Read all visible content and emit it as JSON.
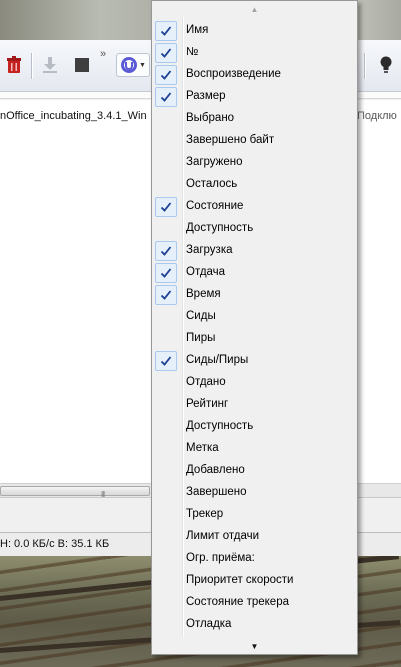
{
  "app": {
    "toolbar": {
      "buttons": [
        {
          "name": "delete-button",
          "icon": "trash-icon"
        },
        {
          "name": "download-button",
          "icon": "download-icon"
        },
        {
          "name": "stop-button",
          "icon": "stop-icon"
        },
        {
          "name": "overflow-button",
          "icon": "double-chevron-icon",
          "glyph": "»"
        },
        {
          "name": "remote-button",
          "icon": "utorrent-icon"
        },
        {
          "name": "tips-button",
          "icon": "lightbulb-icon"
        }
      ]
    },
    "list": {
      "torrent_name": "nOffice_incubating_3.4.1_Win",
      "right_text": "Подклю"
    },
    "status": {
      "text": "Н: 0.0 КБ/с В: 35.1 КБ"
    }
  },
  "menu": {
    "items": [
      {
        "label": "Имя",
        "checked": true
      },
      {
        "label": "№",
        "checked": true
      },
      {
        "label": "Воспроизведение",
        "checked": true
      },
      {
        "label": "Размер",
        "checked": true
      },
      {
        "label": "Выбрано",
        "checked": false
      },
      {
        "label": "Завершено байт",
        "checked": false
      },
      {
        "label": "Загружено",
        "checked": false
      },
      {
        "label": "Осталось",
        "checked": false
      },
      {
        "label": "Состояние",
        "checked": true
      },
      {
        "label": "Доступность",
        "checked": false
      },
      {
        "label": "Загрузка",
        "checked": true
      },
      {
        "label": "Отдача",
        "checked": true
      },
      {
        "label": "Время",
        "checked": true
      },
      {
        "label": "Сиды",
        "checked": false
      },
      {
        "label": "Пиры",
        "checked": false
      },
      {
        "label": "Сиды/Пиры",
        "checked": true
      },
      {
        "label": "Отдано",
        "checked": false
      },
      {
        "label": "Рейтинг",
        "checked": false
      },
      {
        "label": "Доступность",
        "checked": false
      },
      {
        "label": "Метка",
        "checked": false
      },
      {
        "label": "Добавлено",
        "checked": false
      },
      {
        "label": "Завершено",
        "checked": false
      },
      {
        "label": "Трекер",
        "checked": false
      },
      {
        "label": "Лимит отдачи",
        "checked": false
      },
      {
        "label": "Огр. приёма:",
        "checked": false
      },
      {
        "label": "Приоритет скорости",
        "checked": false
      },
      {
        "label": "Состояние трекера",
        "checked": false
      },
      {
        "label": "Отладка",
        "checked": false
      }
    ]
  }
}
